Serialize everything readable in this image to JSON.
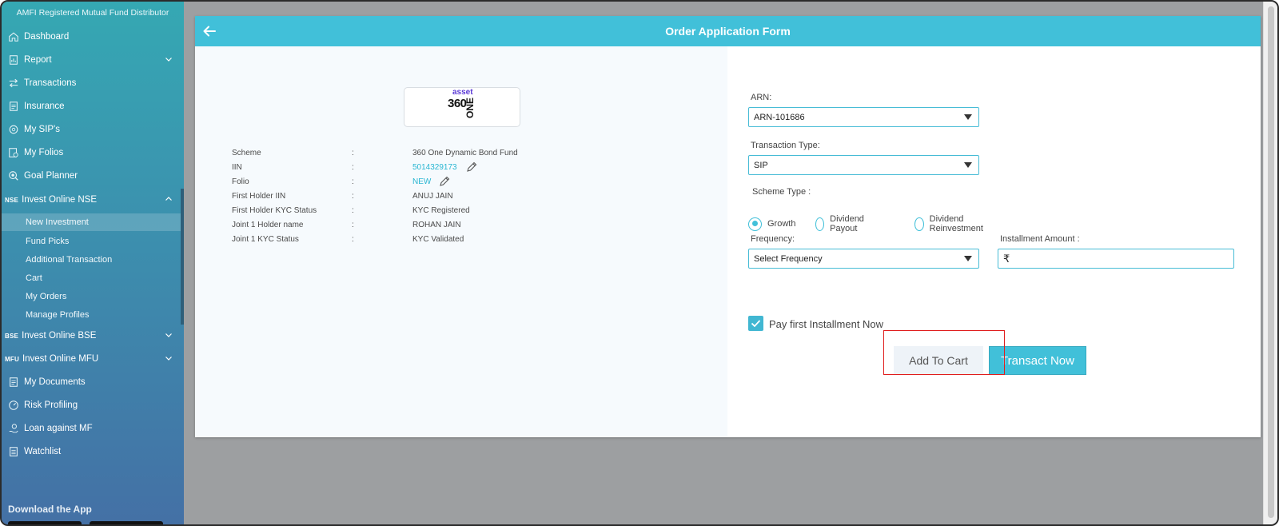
{
  "sidebar": {
    "header": "AMFI Registered Mutual Fund Distributor",
    "items": [
      {
        "label": "Dashboard",
        "icon": "home-icon"
      },
      {
        "label": "Report",
        "icon": "report-icon"
      },
      {
        "label": "Transactions",
        "icon": "transfer-icon"
      },
      {
        "label": "Insurance",
        "icon": "document-icon"
      },
      {
        "label": "My SIP's",
        "icon": "sip-icon"
      },
      {
        "label": "My Folios",
        "icon": "rupee-doc-icon"
      },
      {
        "label": "Goal Planner",
        "icon": "target-icon"
      },
      {
        "label": "Invest Online NSE",
        "tag": "NSE"
      },
      {
        "label": "Invest Online BSE",
        "tag": "BSE"
      },
      {
        "label": "Invest Online MFU",
        "tag": "MFU"
      },
      {
        "label": "My Documents",
        "icon": "document-icon"
      },
      {
        "label": "Risk Profiling",
        "icon": "gauge-icon"
      },
      {
        "label": "Loan against MF",
        "icon": "hand-money-icon"
      },
      {
        "label": "Watchlist",
        "icon": "list-icon"
      }
    ],
    "nse_sub": [
      "New Investment",
      "Fund Picks",
      "Additional Transaction",
      "Cart",
      "My Orders",
      "Manage Profiles"
    ],
    "download": "Download the App"
  },
  "form": {
    "title": "Order Application Form",
    "logo": {
      "top": "asset",
      "main": "360",
      "vertical": "ONE"
    },
    "info": [
      {
        "label": "Scheme",
        "value": "360 One Dynamic Bond Fund"
      },
      {
        "label": "IIN",
        "value": "5014329173"
      },
      {
        "label": "Folio",
        "value": "NEW"
      },
      {
        "label": "First Holder IIN",
        "value": "ANUJ JAIN"
      },
      {
        "label": "First Holder KYC Status",
        "value": "KYC Registered"
      },
      {
        "label": "Joint 1 Holder name",
        "value": "ROHAN JAIN"
      },
      {
        "label": "Joint 1 KYC Status",
        "value": "KYC Validated"
      }
    ],
    "colon": ":",
    "arn_label": "ARN:",
    "arn_value": "ARN-101686",
    "txn_label": "Transaction Type:",
    "txn_value": "SIP",
    "scheme_type_label": "Scheme Type :",
    "scheme_types": [
      "Growth",
      "Dividend Payout",
      "Dividend Reinvestment"
    ],
    "frequency_label": "Frequency:",
    "frequency_value": "Select Frequency",
    "amount_label": "Installment Amount :",
    "currency": "₹",
    "pay_first_label": "Pay first Installment Now",
    "add_to_cart": "Add To Cart",
    "transact_now": "Transact Now"
  },
  "colors": {
    "accent": "#41c0d9",
    "highlight": "#e01d1d"
  }
}
